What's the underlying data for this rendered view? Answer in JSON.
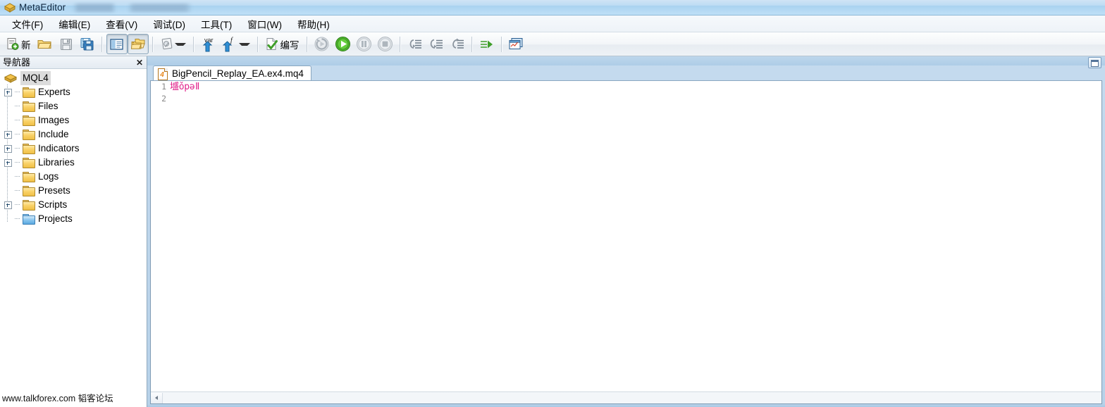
{
  "window": {
    "title": "MetaEditor",
    "title_icon": "metaeditor-logo-icon",
    "redacted_suffix": ""
  },
  "menu": {
    "items": [
      {
        "name": "file",
        "label": "文件(F)"
      },
      {
        "name": "edit",
        "label": "编辑(E)"
      },
      {
        "name": "view",
        "label": "查看(V)"
      },
      {
        "name": "debug",
        "label": "调试(D)"
      },
      {
        "name": "tools",
        "label": "工具(T)"
      },
      {
        "name": "window",
        "label": "窗口(W)"
      },
      {
        "name": "help",
        "label": "帮助(H)"
      }
    ]
  },
  "toolbar": {
    "new_label": "新",
    "compile_label": "编写",
    "buttons": [
      {
        "name": "new-file-button",
        "icon": "new-document-icon"
      },
      {
        "name": "open-file-button",
        "icon": "open-folder-icon"
      },
      {
        "name": "save-button",
        "icon": "floppy-save-icon"
      },
      {
        "name": "save-all-button",
        "icon": "floppy-save-all-icon"
      },
      {
        "name": "toggle-navigator-button",
        "icon": "panel-layout-icon"
      },
      {
        "name": "toggle-folders-button",
        "icon": "folders-icon"
      },
      {
        "name": "clipboard-button",
        "icon": "clipboard-pencil-icon"
      },
      {
        "name": "insert-variable-button",
        "icon": "var-arrow-icon"
      },
      {
        "name": "insert-function-button",
        "icon": "function-arrow-icon"
      },
      {
        "name": "compile-button",
        "icon": "compile-check-icon"
      },
      {
        "name": "restart-debug-button",
        "icon": "restart-debug-icon"
      },
      {
        "name": "start-debug-button",
        "icon": "play-green-icon"
      },
      {
        "name": "pause-debug-button",
        "icon": "pause-icon"
      },
      {
        "name": "stop-debug-button",
        "icon": "stop-icon"
      },
      {
        "name": "step-into-button",
        "icon": "step-into-icon"
      },
      {
        "name": "step-over-button",
        "icon": "step-over-icon"
      },
      {
        "name": "step-out-button",
        "icon": "step-out-icon"
      },
      {
        "name": "run-to-cursor-button",
        "icon": "run-arrow-icon"
      },
      {
        "name": "open-terminal-button",
        "icon": "chart-window-icon"
      }
    ]
  },
  "navigator": {
    "title": "导航器",
    "close_label": "✕",
    "root": {
      "label": "MQL4",
      "icon": "mql4-package-icon",
      "selected": true
    },
    "items": [
      {
        "label": "Experts",
        "expandable": true,
        "folder_color": "yellow"
      },
      {
        "label": "Files",
        "expandable": false,
        "folder_color": "yellow"
      },
      {
        "label": "Images",
        "expandable": false,
        "folder_color": "yellow"
      },
      {
        "label": "Include",
        "expandable": true,
        "folder_color": "yellow"
      },
      {
        "label": "Indicators",
        "expandable": true,
        "folder_color": "yellow"
      },
      {
        "label": "Libraries",
        "expandable": true,
        "folder_color": "yellow"
      },
      {
        "label": "Logs",
        "expandable": false,
        "folder_color": "yellow"
      },
      {
        "label": "Presets",
        "expandable": false,
        "folder_color": "yellow"
      },
      {
        "label": "Scripts",
        "expandable": true,
        "folder_color": "yellow"
      },
      {
        "label": "Projects",
        "expandable": false,
        "folder_color": "blue"
      }
    ]
  },
  "editor": {
    "tab": {
      "title": "BigPencil_Replay_EA.ex4.mq4",
      "icon_number": "4"
    },
    "lines": [
      {
        "number": "1",
        "text": "墭ǒpəǁ"
      },
      {
        "number": "2",
        "text": ""
      }
    ],
    "code_color": "#e0218a"
  },
  "watermark": {
    "text": "www.talkforex.com 韬客论坛"
  }
}
